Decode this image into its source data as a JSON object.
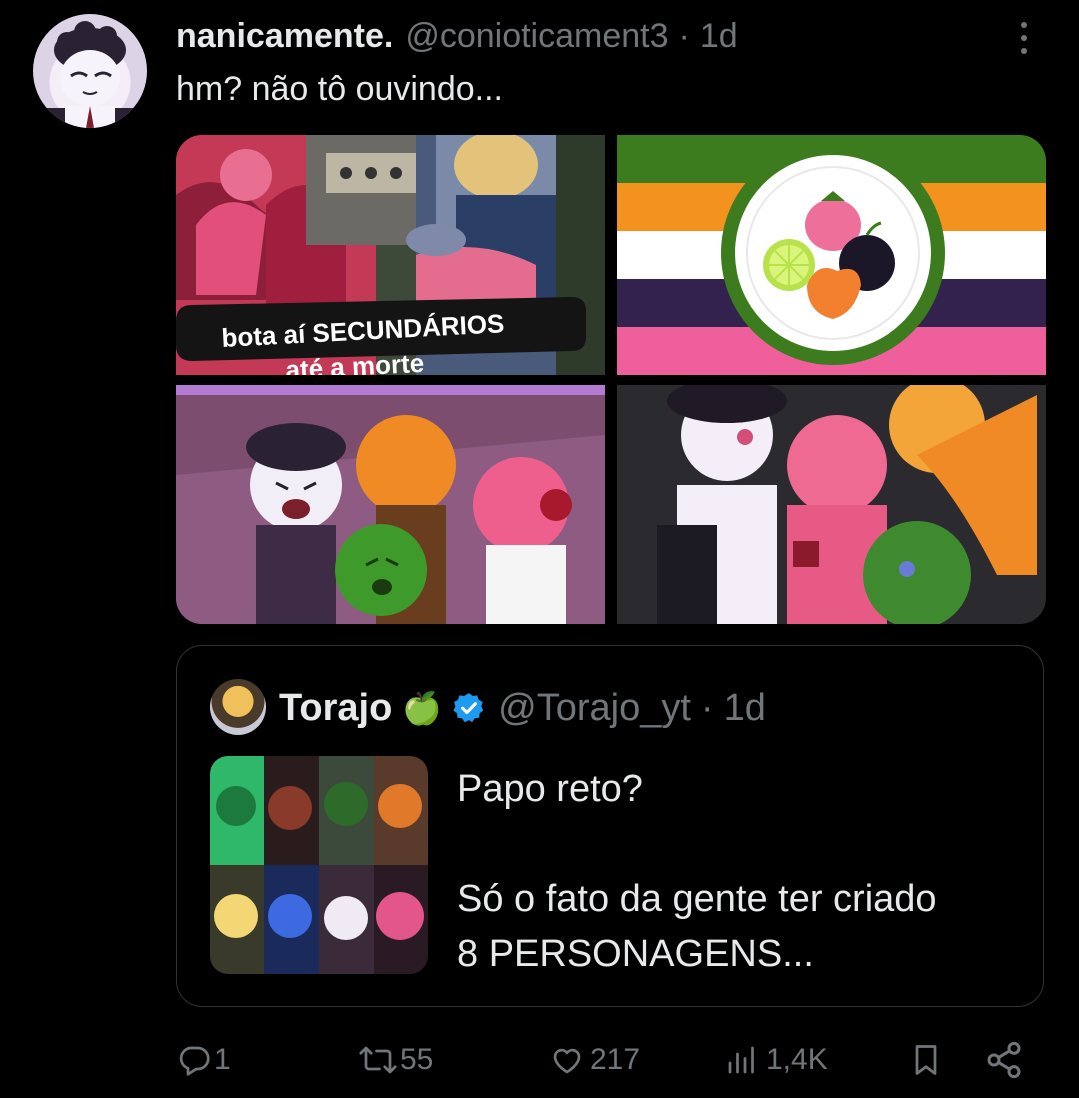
{
  "tweet": {
    "display_name": "nanicamente.",
    "handle": "@conioticament3",
    "separator": "·",
    "time": "1d",
    "text": "hm? não tô ouvindo...",
    "more_icon": "more-vertical-icon",
    "media": [
      {
        "caption_line1": "bota aí SECUNDÁRIOS",
        "caption_line2": "até a morte"
      }
    ]
  },
  "quote": {
    "display_name": "Torajo",
    "emoji": "🍏",
    "verified_icon": "verified-badge-icon",
    "handle": "@Torajo_yt",
    "separator": "·",
    "time": "1d",
    "text_line1": "Papo reto?",
    "text_line2": "Só o fato da gente ter criado",
    "text_line3": "8 PERSONAGENS..."
  },
  "actions": {
    "reply": {
      "icon": "reply-icon",
      "count": "1"
    },
    "repost": {
      "icon": "repost-icon",
      "count": "55"
    },
    "like": {
      "icon": "heart-icon",
      "count": "217"
    },
    "views": {
      "icon": "views-icon",
      "count": "1,4K"
    },
    "bookmark": {
      "icon": "bookmark-icon"
    },
    "share": {
      "icon": "share-icon"
    }
  },
  "colors": {
    "background": "#000000",
    "text": "#e7e9ea",
    "muted": "#71767b",
    "border": "#2f3336",
    "verified": "#1d9bf0"
  }
}
